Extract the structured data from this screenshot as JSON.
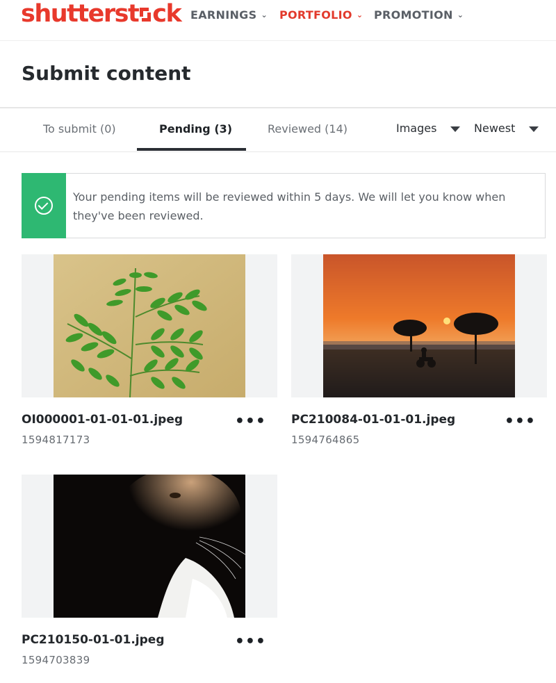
{
  "header": {
    "logo_text": "shutterstock",
    "nav": [
      {
        "label": "EARNINGS",
        "active": false
      },
      {
        "label": "PORTFOLIO",
        "active": true
      },
      {
        "label": "PROMOTION",
        "active": false
      }
    ],
    "chevron": "chevron-down-icon"
  },
  "page": {
    "title": "Submit content"
  },
  "tabs": [
    {
      "label": "To submit (0)",
      "active": false
    },
    {
      "label": "Pending (3)",
      "active": true
    },
    {
      "label": "Reviewed (14)",
      "active": false
    }
  ],
  "filters": {
    "type": "Images",
    "sort": "Newest"
  },
  "notice": {
    "icon": "check-circle-icon",
    "text": "Your pending items will be reviewed within 5 days. We will let you know when they've been reviewed.",
    "accent_color": "#2eb872"
  },
  "items": [
    {
      "filename": "OI000001-01-01-01.jpeg",
      "id": "1594817173",
      "image": "fern-leaves-photo"
    },
    {
      "filename": "PC210084-01-01-01.jpeg",
      "id": "1594764865",
      "image": "sunset-motorbike-photo"
    },
    {
      "filename": "PC210150-01-01.jpeg",
      "id": "1594703839",
      "image": "cat-portrait-photo"
    }
  ],
  "colors": {
    "brand": "#e8392c",
    "active_nav": "#e23a2c",
    "success": "#2eb872"
  }
}
